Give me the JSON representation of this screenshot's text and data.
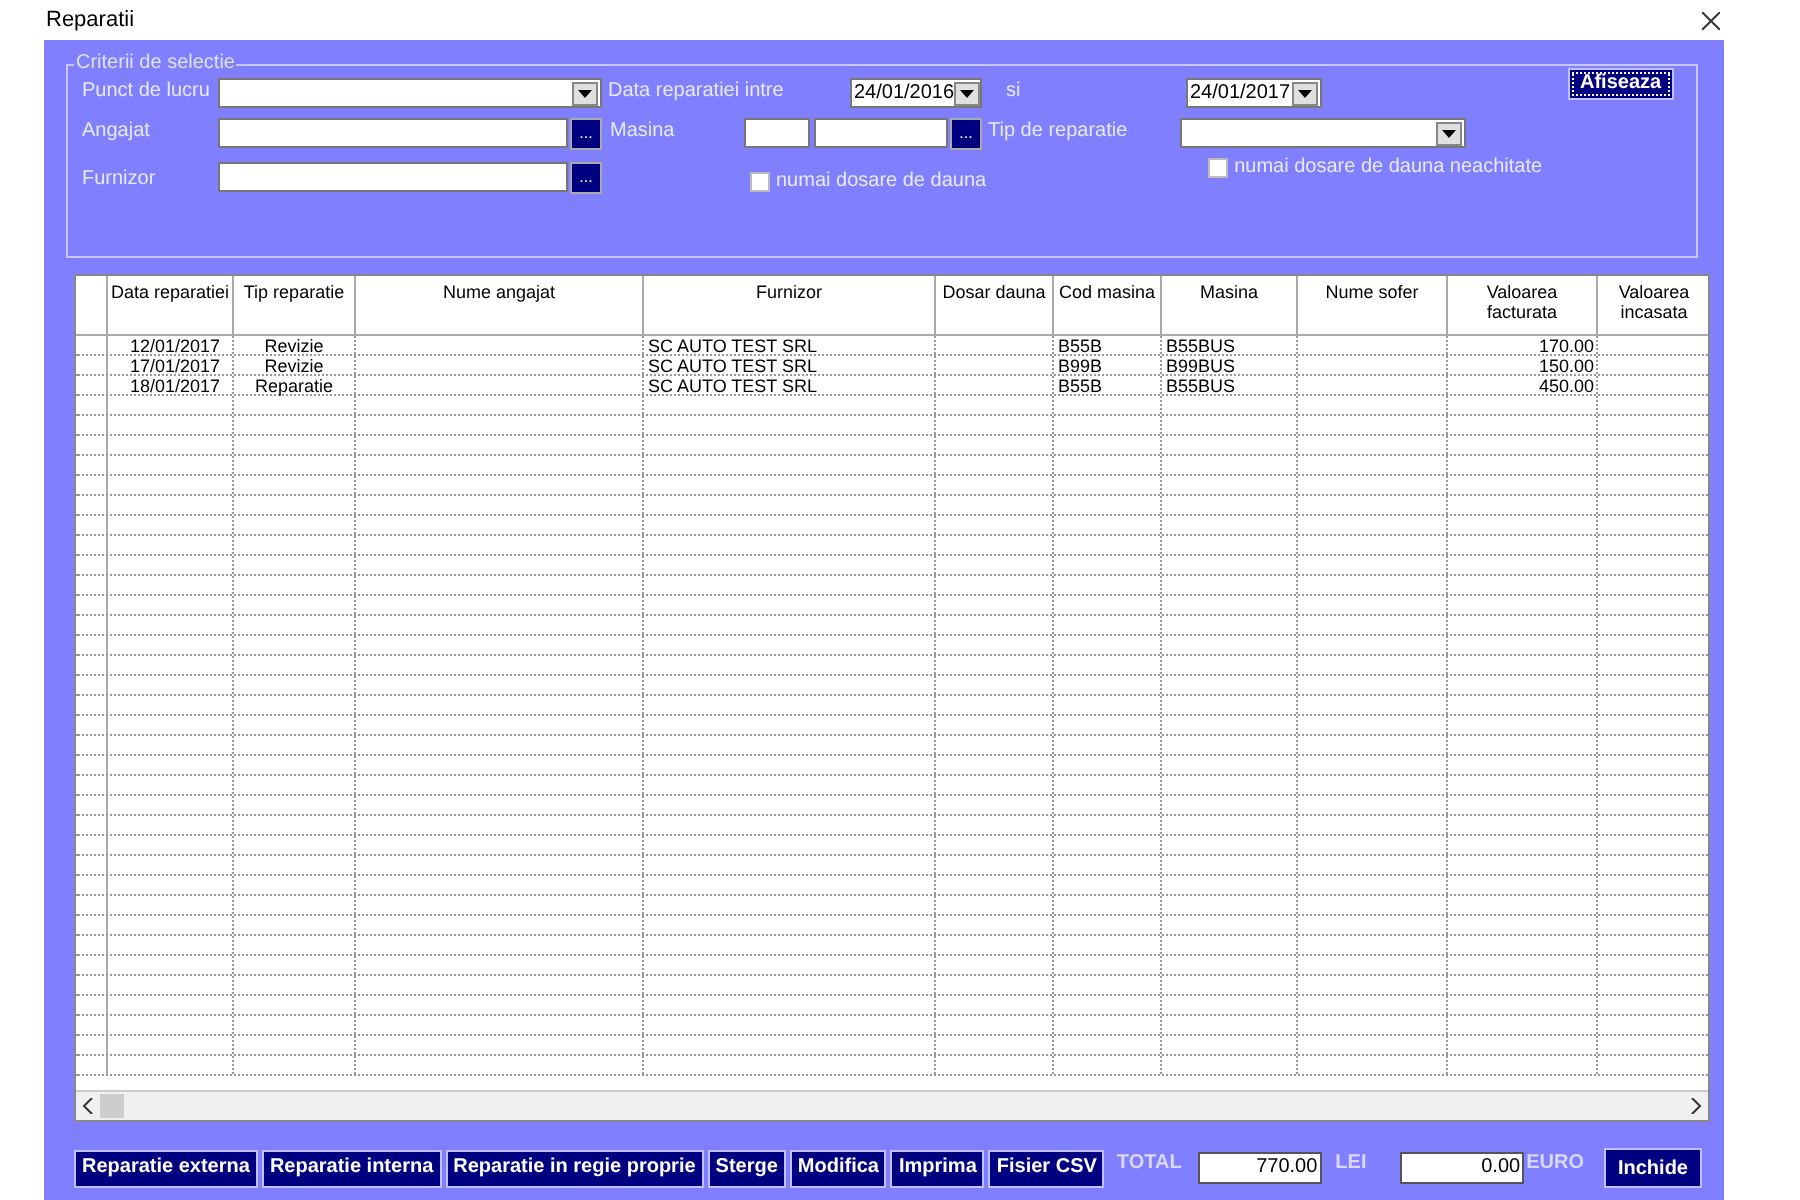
{
  "window": {
    "title": "Reparatii"
  },
  "criteria": {
    "legend": "Criterii de selectie",
    "punct_de_lucru": {
      "label": "Punct de lucru"
    },
    "data_interval": {
      "label": "Data reparatiei intre",
      "from": "24/01/2016",
      "and_label": "si",
      "to": "24/01/2017"
    },
    "angajat": {
      "label": "Angajat",
      "browse": "..."
    },
    "masina": {
      "label": "Masina",
      "browse": "..."
    },
    "tip_reparatie": {
      "label": "Tip de reparatie"
    },
    "furnizor": {
      "label": "Furnizor",
      "browse": "..."
    },
    "checkboxes": [
      {
        "label": "numai dosare de dauna",
        "checked": false
      },
      {
        "label": "numai dosare de dauna neachitate",
        "checked": false
      }
    ],
    "show_button": "Afiseaza"
  },
  "table": {
    "columns": [
      "Data reparatiei",
      "Tip reparatie",
      "Nume angajat",
      "Furnizor",
      "Dosar dauna",
      "Cod masina",
      "Masina",
      "Nume sofer",
      "Valoarea facturata",
      "Valoarea incasata"
    ],
    "rows": [
      [
        "12/01/2017",
        "Revizie",
        "",
        "SC AUTO TEST SRL",
        "",
        "B55B",
        "B55BUS",
        "",
        "170.00",
        ""
      ],
      [
        "17/01/2017",
        "Revizie",
        "",
        "SC AUTO TEST SRL",
        "",
        "B99B",
        "B99BUS",
        "",
        "150.00",
        ""
      ],
      [
        "18/01/2017",
        "Reparatie",
        "",
        "SC AUTO TEST SRL",
        "",
        "B55B",
        "B55BUS",
        "",
        "450.00",
        ""
      ]
    ]
  },
  "footer": {
    "buttons": [
      "Reparatie externa",
      "Reparatie interna",
      "Reparatie in regie proprie",
      "Sterge",
      "Modifica",
      "Imprima",
      "Fisier CSV"
    ],
    "total_label": "TOTAL",
    "total_lei": "770.00",
    "lei_label": "LEI",
    "total_euro": "0.00",
    "euro_label": "EURO",
    "close_button": "Inchide"
  }
}
